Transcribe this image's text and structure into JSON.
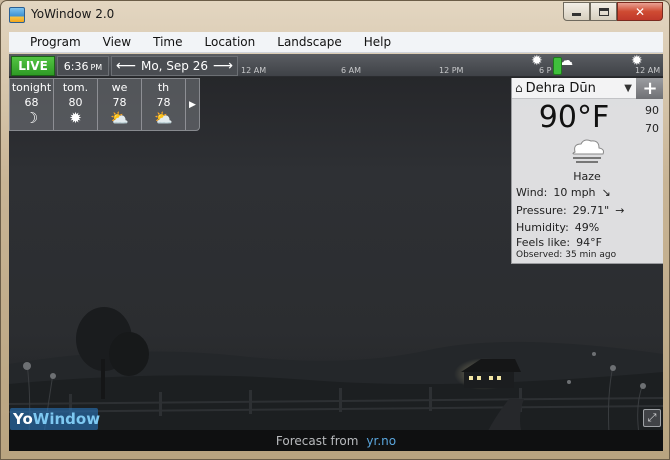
{
  "window": {
    "title": "YoWindow 2.0"
  },
  "menubar": {
    "items": [
      "Program",
      "View",
      "Time",
      "Location",
      "Landscape",
      "Help"
    ]
  },
  "timebar": {
    "live_label": "LIVE",
    "time": "6:36",
    "ampm": "PM",
    "date": "Mo, Sep 26",
    "timeline_labels": [
      "12 AM",
      "6 AM",
      "12 PM",
      "6 P",
      "12 AM"
    ]
  },
  "forecast": {
    "days": [
      {
        "name": "tonight",
        "temp": "68",
        "icon": "moon-icon"
      },
      {
        "name": "tom.",
        "temp": "80",
        "icon": "sun-icon"
      },
      {
        "name": "we",
        "temp": "78",
        "icon": "sun-cloud-icon"
      },
      {
        "name": "th",
        "temp": "78",
        "icon": "sun-cloud-icon"
      }
    ]
  },
  "current": {
    "location": "Dehra Dūn",
    "temperature": "90°F",
    "high": "90",
    "low": "70",
    "condition": "Haze",
    "wind_label": "Wind:",
    "wind_value": "10 mph",
    "wind_dir": "↘",
    "pressure_label": "Pressure:",
    "pressure_value": "29.71\"",
    "pressure_trend": "→",
    "humidity_label": "Humidity:",
    "humidity_value": "49%",
    "feels_label": "Feels like:",
    "feels_value": "94°F",
    "observed_label": "Observed:",
    "observed_value": "35 min ago"
  },
  "bottom": {
    "logo_yo": "Yo",
    "logo_window": "Window",
    "forecast_from": "Forecast from",
    "source": "yr.no"
  },
  "colors": {
    "live_green": "#2e9b25",
    "link_blue": "#5aa6dd",
    "close_red": "#c0392b"
  }
}
